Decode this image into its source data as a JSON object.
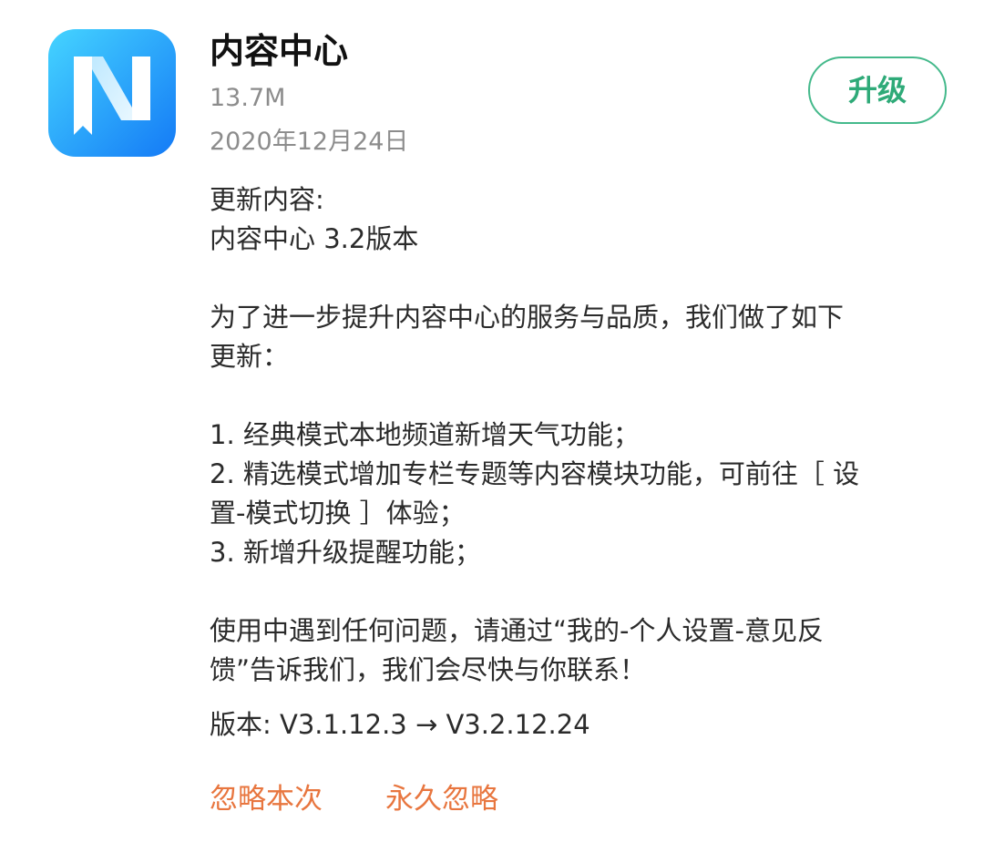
{
  "app": {
    "name": "内容中心",
    "size": "13.7M",
    "date": "2020年12月24日",
    "icon": "news-app-icon",
    "icon_colors": {
      "gradient_start": "#3fd0ff",
      "gradient_end": "#1479f5",
      "glyph": "#ffffff"
    }
  },
  "upgrade_button": {
    "label": "升级",
    "color": "#2eaa78"
  },
  "changelog": {
    "lines": [
      "更新内容:",
      "内容中心 3.2版本",
      "",
      "为了进一步提升内容中心的服务与品质，我们做了如下",
      "更新：",
      "",
      "1. 经典模式本地频道新增天气功能；",
      "2. 精选模式增加专栏专题等内容模块功能，可前往［ 设",
      "置-模式切换 ］体验；",
      "3. 新增升级提醒功能；",
      "",
      "使用中遇到任何问题，请通过“我的-个人设置-意见反",
      "馈”告诉我们，我们会尽快与你联系！"
    ]
  },
  "version": {
    "text": "版本: V3.1.12.3 → V3.2.12.24"
  },
  "actions": {
    "ignore_once": "忽略本次",
    "ignore_forever": "永久忽略",
    "color": "#e8763f"
  }
}
